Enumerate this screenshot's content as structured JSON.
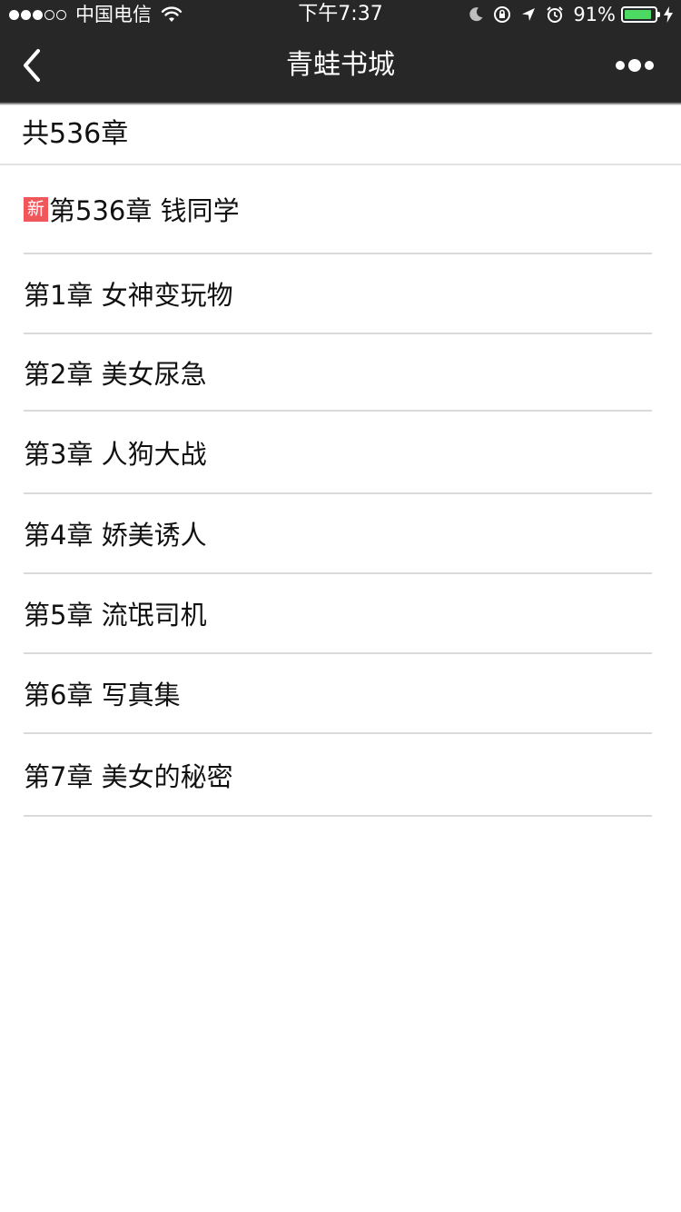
{
  "status_bar": {
    "carrier": "中国电信",
    "time": "下午7:37",
    "battery": "91%",
    "battery_level": 0.91
  },
  "nav": {
    "title": "青蛙书城"
  },
  "chapters_header": {
    "count_label": "共536章"
  },
  "chapters": {
    "new_badge": "新",
    "latest": "第536章 钱同学",
    "items": [
      "第1章 女神变玩物",
      "第2章 美女尿急",
      "第3章 人狗大战",
      "第4章 娇美诱人",
      "第5章 流氓司机",
      "第6章 写真集",
      "第7章 美女的秘密"
    ]
  },
  "colors": {
    "bar_background": "#272727",
    "new_badge": "#f0575b",
    "battery_fill": "#4cd964",
    "divider": "#dadada"
  }
}
